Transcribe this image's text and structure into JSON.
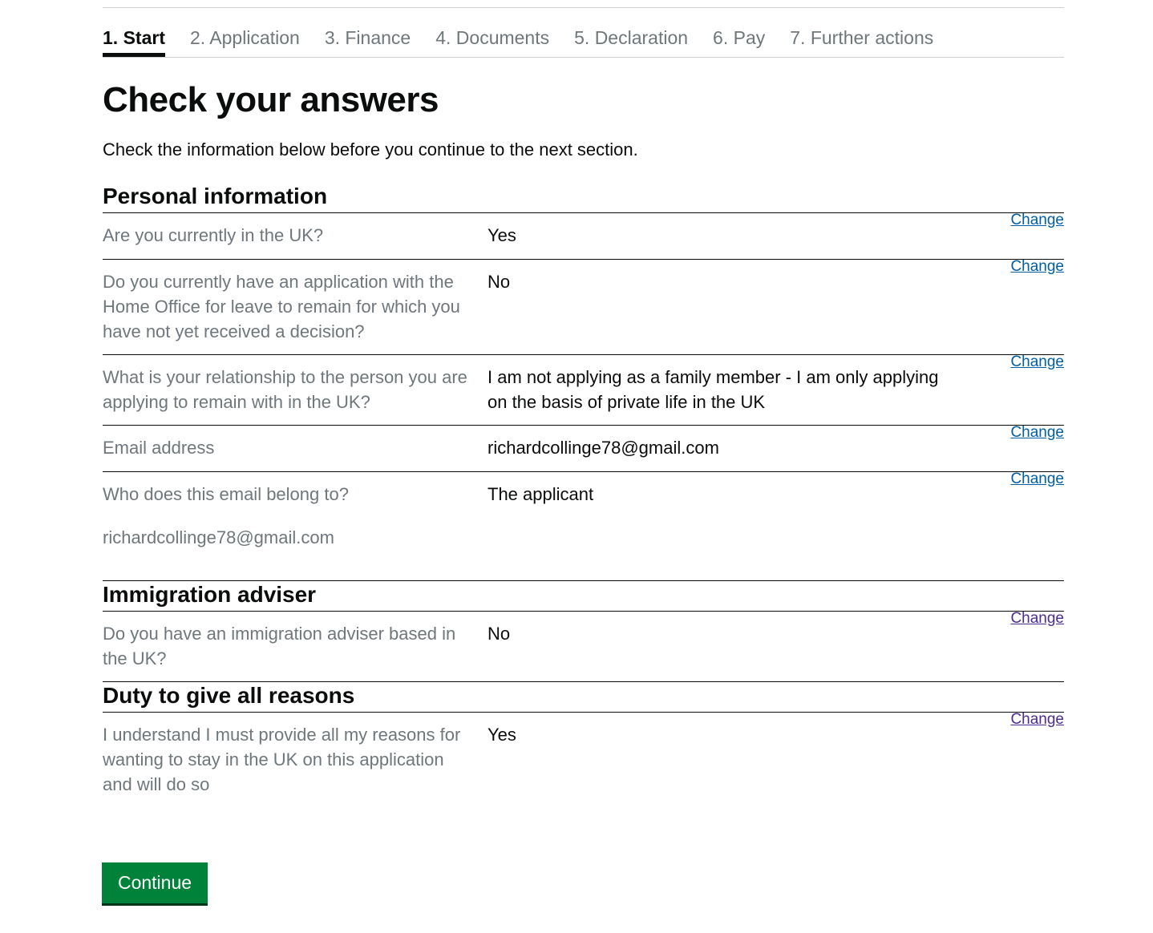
{
  "steps": [
    "1. Start",
    "2. Application",
    "3. Finance",
    "4. Documents",
    "5. Declaration",
    "6. Pay",
    "7. Further actions"
  ],
  "active_step": 0,
  "page_title": "Check your answers",
  "intro": "Check the information below before you continue to the next section.",
  "change_label": "Change",
  "sections": [
    {
      "title": "Personal information",
      "rows": [
        {
          "question": "Are you currently in the UK?",
          "answer": "Yes"
        },
        {
          "question": "Do you currently have an application with the Home Office for leave to remain for which you have not yet received a decision?",
          "answer": "No"
        },
        {
          "question": "What is your relationship to the person you are applying to remain with in the UK?",
          "answer": "I am not applying as a family member - I am only applying on the basis of private life in the UK"
        },
        {
          "question": "Email address",
          "answer": "richardcollinge78@gmail.com"
        },
        {
          "question": "Who does this email belong to?",
          "answer": "The applicant",
          "extra": "richardcollinge78@gmail.com"
        }
      ]
    },
    {
      "title": "Immigration adviser",
      "rows": [
        {
          "question": "Do you have an immigration adviser based in the UK?",
          "answer": "No"
        }
      ]
    },
    {
      "title": "Duty to give all reasons",
      "rows": [
        {
          "question": "I understand I must provide all my reasons for wanting to stay in the UK on this application and will do so",
          "answer": "Yes"
        }
      ]
    }
  ],
  "continue_label": "Continue",
  "colors": {
    "link": "#005ea5",
    "link_visited": "#4c2c92",
    "button": "#00823b",
    "secondary_text": "#6f777b"
  }
}
